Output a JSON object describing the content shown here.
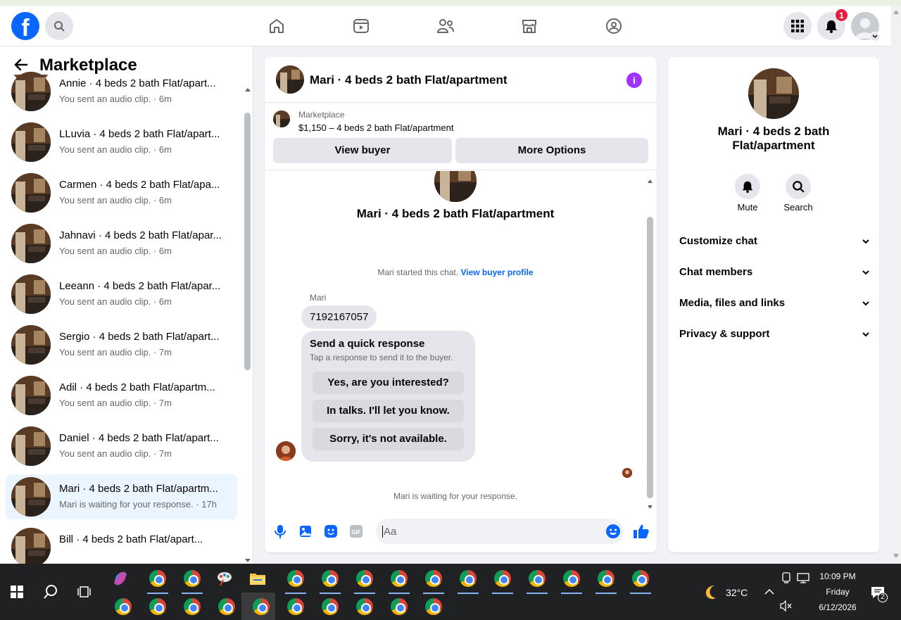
{
  "app": {
    "name": "Facebook",
    "section_title": "Marketplace",
    "logo_letter": "f"
  },
  "header": {
    "notification_count": "1"
  },
  "conversations": [
    {
      "name": "Annie · 4 beds 2 bath Flat/apart...",
      "sub": "You sent an audio clip. · 6m"
    },
    {
      "name": "LLuvia · 4 beds 2 bath Flat/apart...",
      "sub": "You sent an audio clip. · 6m"
    },
    {
      "name": "Carmen · 4 beds 2 bath Flat/apa...",
      "sub": "You sent an audio clip. · 6m"
    },
    {
      "name": "Jahnavi · 4 beds 2 bath Flat/apar...",
      "sub": "You sent an audio clip. · 6m"
    },
    {
      "name": "Leeann · 4 beds 2 bath Flat/apar...",
      "sub": "You sent an audio clip. · 6m"
    },
    {
      "name": "Sergio · 4 beds 2 bath Flat/apart...",
      "sub": "You sent an audio clip. · 7m"
    },
    {
      "name": "Adil · 4 beds 2 bath Flat/apartm...",
      "sub": "You sent an audio clip. · 7m"
    },
    {
      "name": "Daniel · 4 beds 2 bath Flat/apart...",
      "sub": "You sent an audio clip. · 7m"
    },
    {
      "name": "Mari · 4 beds 2 bath Flat/apartm...",
      "sub": "Mari is waiting for your response. · 17h"
    },
    {
      "name": "Bill · 4 beds 2 bath Flat/apart...",
      "sub": ""
    }
  ],
  "chat": {
    "title": "Mari · 4 beds 2 bath Flat/apartment",
    "listing_source": "Marketplace",
    "listing_price_title": "$1,150 – 4 beds 2 bath Flat/apartment",
    "view_buyer": "View buyer",
    "more_options": "More Options",
    "intro_name": "Mari · 4 beds 2 bath Flat/apartment",
    "started_text": "Mari started this chat.",
    "view_profile": "View buyer profile",
    "sender": "Mari",
    "message": "7192167057",
    "quick_title": "Send a quick response",
    "quick_sub": "Tap a response to send it to the buyer.",
    "quick_replies": [
      "Yes, are you interested?",
      "In talks. I'll let you know.",
      "Sorry, it's not available."
    ],
    "waiting_text": "Mari is waiting for your response.",
    "composer_placeholder": "Aa"
  },
  "details": {
    "name": "Mari · 4 beds 2 bath Flat/apartment",
    "mute": "Mute",
    "search": "Search",
    "menu": [
      "Customize chat",
      "Chat members",
      "Media, files and links",
      "Privacy & support"
    ]
  },
  "taskbar": {
    "temperature": "32°C",
    "time": "10:09 PM",
    "day": "Friday",
    "date": "6/12/2026",
    "notif_count": "2"
  }
}
